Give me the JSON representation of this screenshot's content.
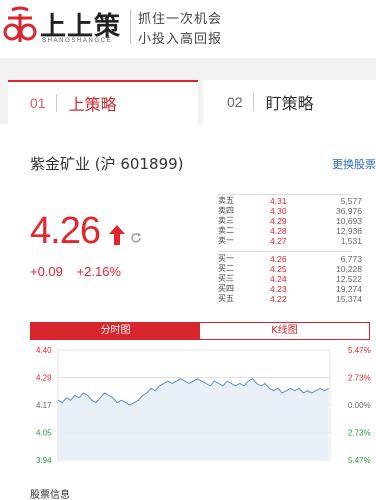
{
  "header": {
    "logo_text": "上上策",
    "logo_en": "SHANGSHANGCE",
    "slogan_line1": "抓住一次机会",
    "slogan_line2": "小投入高回报"
  },
  "tabs": [
    {
      "num": "01",
      "label": "上策略",
      "active": true
    },
    {
      "num": "02",
      "label": "盯策略",
      "active": false
    }
  ],
  "stock": {
    "title": "紫金矿业 (沪 601899)",
    "change_link": "更换股票",
    "price": "4.26",
    "change": "+0.09",
    "change_pct": "+2.16%"
  },
  "order_book": {
    "sell": [
      {
        "label": "卖五",
        "price": "4.31",
        "vol": "5,577"
      },
      {
        "label": "卖四",
        "price": "4.30",
        "vol": "36,976"
      },
      {
        "label": "卖三",
        "price": "4.29",
        "vol": "10,693"
      },
      {
        "label": "卖二",
        "price": "4.28",
        "vol": "12,936"
      },
      {
        "label": "卖一",
        "price": "4.27",
        "vol": "1,531"
      }
    ],
    "buy": [
      {
        "label": "买一",
        "price": "4.26",
        "vol": "6,773"
      },
      {
        "label": "买二",
        "price": "4.25",
        "vol": "10,228"
      },
      {
        "label": "买三",
        "price": "4.24",
        "vol": "12,522"
      },
      {
        "label": "买四",
        "price": "4.23",
        "vol": "19,274"
      },
      {
        "label": "买五",
        "price": "4.22",
        "vol": "15,374"
      }
    ]
  },
  "chart_tabs": [
    {
      "label": "分时图",
      "active": true
    },
    {
      "label": "K线图",
      "active": false
    }
  ],
  "chart_data": {
    "type": "line",
    "y_left_labels": [
      "4.40",
      "4.29",
      "4.17",
      "4.05",
      "3.94"
    ],
    "y_right_labels": [
      "5.47%",
      "2.73%",
      "0.00%",
      "2.73%",
      "5.47%"
    ],
    "ylim": [
      3.94,
      4.4
    ],
    "values": [
      4.19,
      4.18,
      4.2,
      4.19,
      4.21,
      4.2,
      4.22,
      4.21,
      4.19,
      4.18,
      4.2,
      4.22,
      4.21,
      4.2,
      4.18,
      4.19,
      4.18,
      4.17,
      4.18,
      4.19,
      4.21,
      4.22,
      4.24,
      4.23,
      4.25,
      4.26,
      4.27,
      4.26,
      4.27,
      4.28,
      4.27,
      4.26,
      4.27,
      4.28,
      4.27,
      4.26,
      4.25,
      4.27,
      4.26,
      4.25,
      4.27,
      4.26,
      4.25,
      4.26,
      4.25,
      4.27,
      4.28,
      4.26,
      4.25,
      4.26,
      4.24,
      4.23,
      4.24,
      4.22,
      4.23,
      4.24,
      4.23,
      4.24,
      4.22,
      4.23,
      4.22,
      4.23,
      4.24,
      4.23,
      4.24
    ],
    "colors": {
      "line": "#5b8fc6",
      "fill": "#e3ecf6",
      "grid": "#e3e3e3",
      "pos_label": "#e3262e",
      "neg_label": "#2a9a3a"
    }
  },
  "footer": {
    "label": "股票信息"
  }
}
